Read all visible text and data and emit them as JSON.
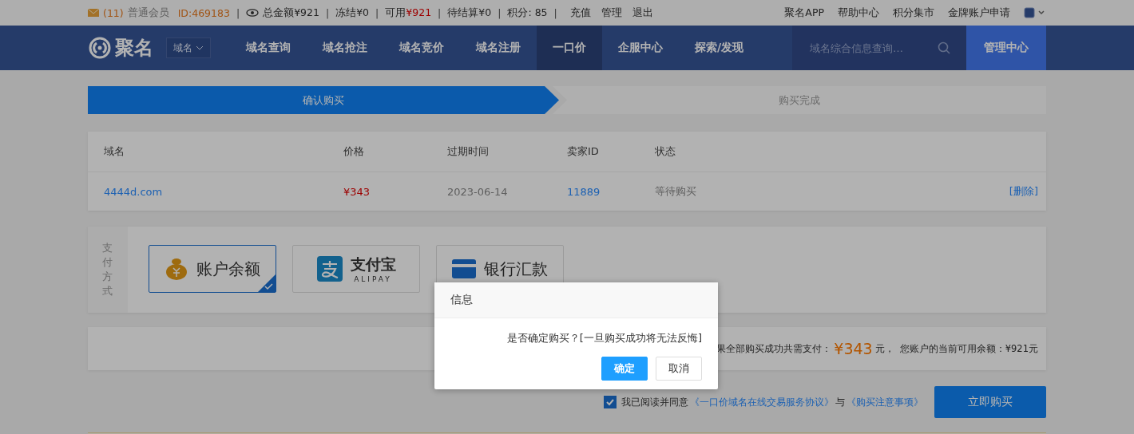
{
  "top_bar": {
    "mail_count": "(11)",
    "member": "普通会员",
    "user_id": "ID:469183",
    "stats": [
      {
        "separator": "|",
        "label": "总金额",
        "value": "¥921",
        "highlight": false
      },
      {
        "separator": "|",
        "label": "冻结",
        "value": "¥0",
        "highlight": false
      },
      {
        "separator": "|",
        "label": "可用",
        "value": "¥921",
        "highlight": true
      },
      {
        "separator": "|",
        "label": "待结算",
        "value": "¥0",
        "highlight": false
      },
      {
        "separator": "|",
        "label": "积分:",
        "value": " 85",
        "highlight": false
      }
    ],
    "links_separator": "|",
    "links": [
      "充值",
      "管理",
      "退出"
    ],
    "right_links": [
      "聚名APP",
      "帮助中心",
      "积分集市",
      "金牌账户申请"
    ]
  },
  "nav": {
    "logo": "聚名",
    "selector": "域名",
    "items": [
      {
        "label": "域名查询",
        "selected": false
      },
      {
        "label": "域名抢注",
        "selected": false
      },
      {
        "label": "域名竞价",
        "selected": false
      },
      {
        "label": "域名注册",
        "selected": false
      },
      {
        "label": "一口价",
        "selected": true
      },
      {
        "label": "企服中心",
        "selected": false
      },
      {
        "label": "探索/发现",
        "selected": false
      }
    ],
    "search": {
      "placeholder": "域名综合信息查询…"
    },
    "manage": "管理中心"
  },
  "steps": [
    {
      "label": "确认购买",
      "selected": true
    },
    {
      "label": "购买完成",
      "selected": false
    }
  ],
  "table": {
    "columns": [
      "域名",
      "价格",
      "过期时间",
      "卖家ID",
      "状态"
    ],
    "rows": [
      {
        "domain": "4444d.com",
        "price": "¥343",
        "expiry": "2023-06-14",
        "seller": "11889",
        "status": "等待购买",
        "action": "[删除]"
      }
    ]
  },
  "payment": {
    "label": "支付方式",
    "methods": [
      {
        "kind": "balance",
        "label": "账户余额",
        "selected": true
      },
      {
        "kind": "alipay",
        "label": "支付宝",
        "sublabel": "ALIPAY",
        "selected": false
      },
      {
        "kind": "bank",
        "label": "银行汇款",
        "selected": false
      }
    ]
  },
  "summary": {
    "prefix": "果全部购买成功共需支付：",
    "amount": "¥343",
    "unit": "元，",
    "balance": "您账户的当前可用余额：¥921元"
  },
  "agreement": {
    "checked": true,
    "text": "我已阅读并同意",
    "links": [
      "《一口价域名在线交易服务协议》",
      "《购买注意事项》"
    ],
    "joiner": "与"
  },
  "buy_button": "立即购买",
  "dialog": {
    "title": "信息",
    "message": "是否确定购买？[一旦购买成功将无法反悔]",
    "confirm": "确定",
    "cancel": "取消"
  }
}
